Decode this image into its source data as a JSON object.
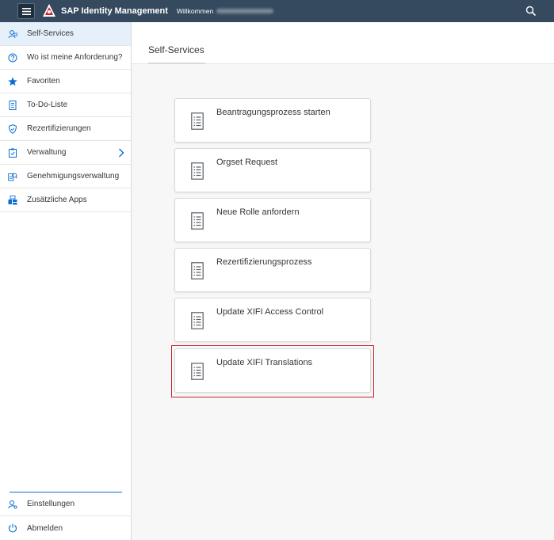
{
  "shell": {
    "app_title": "SAP Identity Management",
    "welcome": "Willkommen",
    "menu_icon": "hamburger-icon",
    "search_icon": "search-icon",
    "accent_color": "#354a5f"
  },
  "sidenav": {
    "items": [
      {
        "label": "Self-Services",
        "icon": "self-service-icon",
        "selected": true
      },
      {
        "label": "Wo ist meine Anforderung?",
        "icon": "question-icon"
      },
      {
        "label": "Favoriten",
        "icon": "star-icon"
      },
      {
        "label": "To-Do-Liste",
        "icon": "task-list-icon"
      },
      {
        "label": "Rezertifizierungen",
        "icon": "shield-icon"
      },
      {
        "label": "Verwaltung",
        "icon": "clipboard-check-icon",
        "has_submenu": true
      },
      {
        "label": "Genehmigungsverwaltung",
        "icon": "approval-icon"
      },
      {
        "label": "Zusätzliche Apps",
        "icon": "apps-icon"
      }
    ],
    "footer": [
      {
        "label": "Einstellungen",
        "icon": "settings-icon"
      },
      {
        "label": "Abmelden",
        "icon": "logout-icon"
      }
    ],
    "selected_color": "#e5f0fa",
    "icon_color": "#0a6ed1"
  },
  "main": {
    "title": "Self-Services",
    "tiles": [
      {
        "label": "Beantragungsprozess starten",
        "icon": "form-icon"
      },
      {
        "label": "Orgset Request",
        "icon": "form-icon"
      },
      {
        "label": "Neue Rolle anfordern",
        "icon": "form-icon"
      },
      {
        "label": "Rezertifizierungsprozess",
        "icon": "form-icon"
      },
      {
        "label": "Update XIFI Access Control",
        "icon": "form-icon"
      },
      {
        "label": "Update XIFI Translations",
        "icon": "form-icon",
        "highlighted": true
      }
    ],
    "highlight_color": "#c8202c"
  }
}
